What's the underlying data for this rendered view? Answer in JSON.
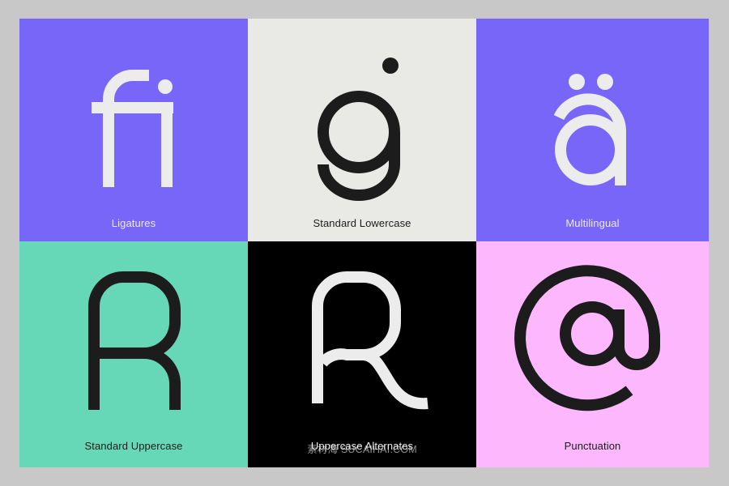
{
  "colors": {
    "background": "#c8c8c8",
    "violet": "#7766f7",
    "offwhite": "#e9eae6",
    "mint": "#67d8b7",
    "black": "#000000",
    "pink": "#fdb8fd",
    "ink": "#1c1c1c",
    "paper": "#ececec"
  },
  "tiles": [
    {
      "label": "Ligatures",
      "glyph": "fi-ligature-glyph"
    },
    {
      "label": "Standard Lowercase",
      "glyph": "g-lowercase-glyph"
    },
    {
      "label": "Multilingual",
      "glyph": "a-umlaut-glyph"
    },
    {
      "label": "Standard Uppercase",
      "glyph": "R-uppercase-glyph"
    },
    {
      "label": "Uppercase Alternates",
      "glyph": "R-alternate-glyph"
    },
    {
      "label": "Punctuation",
      "glyph": "at-sign-glyph"
    }
  ],
  "watermark": "素材海 SUCAIHAI.COM"
}
